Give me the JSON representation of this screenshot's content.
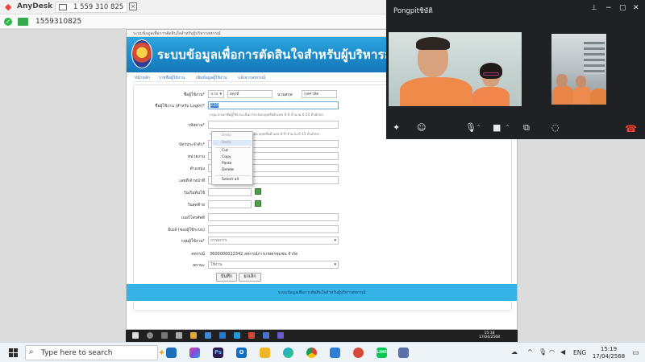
{
  "anydesk": {
    "app_name": "AnyDesk",
    "tab_label": "1 559 310 825",
    "address": "1559310825"
  },
  "remote": {
    "window_title": "ระบบข้อมูลเพื่อการตัดสินใจสำหรับผู้บริหารสหกรณ์",
    "banner_title": "ระบบข้อมูลเพื่อการตัดสินใจสำหรับผู้บริหารสหกรณ์",
    "breadcrumbs": [
      "หน้าหลัก",
      "รายชื่อผู้ใช้งาน",
      "เพิ่มข้อมูลผู้ใช้งาน",
      "แจ้งจากสหกรณ์"
    ],
    "form": {
      "name_label": "ชื่อผู้ใช้งาน*",
      "prefix_value": "นาย",
      "firstname_value": "ผดุงธ์",
      "lastname_label": "นามสกุล",
      "lastname_value": "กุลศาลิต",
      "login_label": "ชื่อผู้ใช้งาน (สำหรับ Login)*",
      "login_value": "220",
      "login_hint": "กรุณากรอกชื่อผู้ใช้งาน เป็นภาษาอังกฤษหรือตัวเลข 0-9 จำนวน 6-15 ตัวอักษร",
      "password_label": "รหัสผ่าน*",
      "password_hint": "กรุณากรอกรหัสผ่าน เป็นภาษาอังกฤษหรือตัวเลข 0-9 จำนวน 6-15 ตัวอักษร",
      "id_card_label": "บัตรประจำตัว*",
      "agency_label": "หน่วยงาน",
      "position_label": "ตำแหน่ง",
      "officer_id_label": "เลขที่เจ้าหน้าที่",
      "start_date_label": "วันเริ่มต้นใช้",
      "expire_date_label": "วันสุดท้าย",
      "phone_label": "เบอร์โทรศัพท์",
      "email_label": "อีเมล์ (ของผู้ใช้ระบบ)",
      "group_label": "กลุ่มผู้ใช้งาน*",
      "group_value": "กรรมการ",
      "coop_label": "สหกรณ์",
      "coop_value": "3600000022342 สหกรณ์การเกษตรชุมชน จำกัด",
      "status_label": "สถานะ",
      "status_value": "ใช้งาน",
      "save_button": "บันทึก",
      "cancel_button": "ยกเลิก"
    },
    "footer_text": "ระบบข้อมูลเพื่อการตัดสินใจสำหรับผู้บริหารสหกรณ์",
    "context_menu": [
      "Undo",
      "Redo",
      "Cut",
      "Copy",
      "Paste",
      "Delete",
      "Select all"
    ],
    "inner_clock": {
      "time": "15:18",
      "date": "17/04/2568"
    }
  },
  "meet": {
    "participant_name": "Pongpitชิษัติ"
  },
  "taskbar": {
    "search_placeholder": "Type here to search",
    "language": "ENG",
    "time": "15:19",
    "date": "17/04/2568"
  },
  "colors": {
    "anydesk_red": "#ef443b",
    "banner_blue": "#1b88c8",
    "footer_blue": "#35b3e7",
    "meet_bg": "#202124",
    "end_call": "#ea4335"
  }
}
